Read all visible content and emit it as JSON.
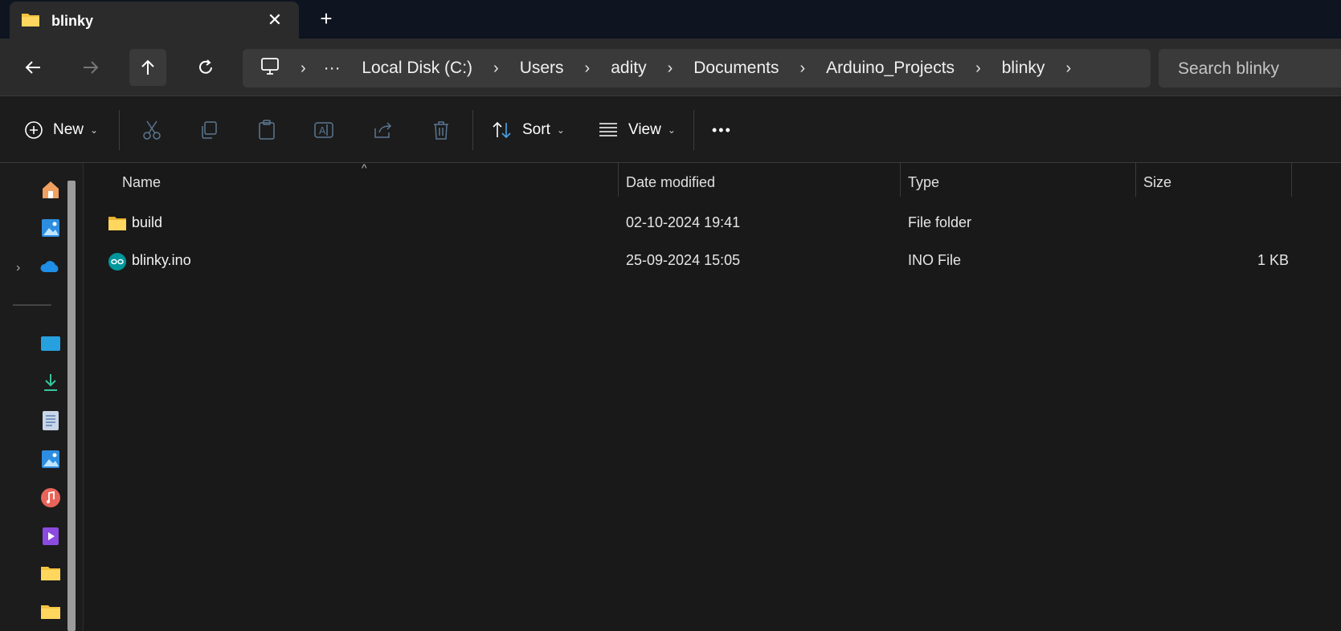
{
  "tab": {
    "title": "blinky",
    "close": "✕",
    "new_tab": "+"
  },
  "nav": {
    "back": "back-arrow-icon",
    "forward": "forward-arrow-icon",
    "up": "up-arrow-icon",
    "refresh": "refresh-icon"
  },
  "address": {
    "overflow": "···",
    "crumbs": [
      "Local Disk (C:)",
      "Users",
      "adity",
      "Documents",
      "Arduino_Projects",
      "blinky"
    ]
  },
  "search": {
    "placeholder": "Search blinky"
  },
  "toolbar": {
    "new_label": "New",
    "sort_label": "Sort",
    "view_label": "View",
    "more": "•••"
  },
  "columns": {
    "name": "Name",
    "date": "Date modified",
    "type": "Type",
    "size": "Size"
  },
  "files": [
    {
      "name": "build",
      "date": "02-10-2024 19:41",
      "type": "File folder",
      "size": "",
      "icon": "folder-icon"
    },
    {
      "name": "blinky.ino",
      "date": "25-09-2024 15:05",
      "type": "INO File",
      "size": "1 KB",
      "icon": "arduino-file-icon"
    }
  ],
  "colors": {
    "titlebar": "#0e1420",
    "surface": "#2b2b2b",
    "background": "#191919",
    "folder": "#f4c440",
    "accent": "#4aa3e8"
  }
}
